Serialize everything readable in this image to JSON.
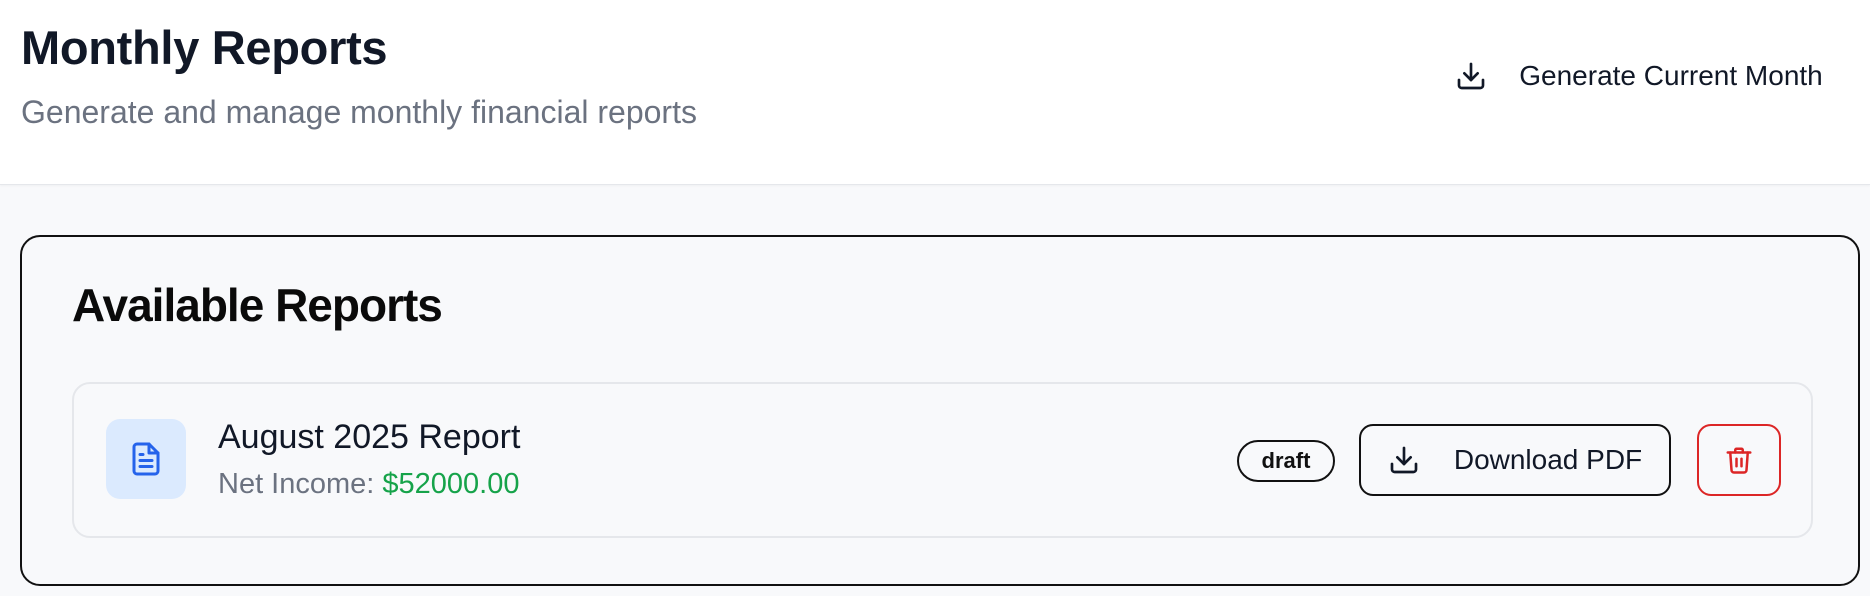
{
  "header": {
    "title": "Monthly Reports",
    "subtitle": "Generate and manage monthly financial reports",
    "generate_button": {
      "label": "Generate Current Month",
      "icon": "download-icon"
    }
  },
  "reports_section": {
    "title": "Available Reports",
    "reports": [
      {
        "name": "August 2025 Report",
        "net_income_label": "Net Income:",
        "net_income_value": "$52000.00",
        "status": "draft",
        "icon": "document-icon",
        "download_label": "Download PDF",
        "download_icon": "download-icon",
        "delete_icon": "trash-icon"
      }
    ]
  },
  "colors": {
    "title": "#111827",
    "subtitle": "#6b7280",
    "income": "#16a34a",
    "doc_icon": "#2563eb",
    "doc_icon_bg": "#dbeafe",
    "delete": "#dc2626",
    "border_dark": "#111111"
  }
}
